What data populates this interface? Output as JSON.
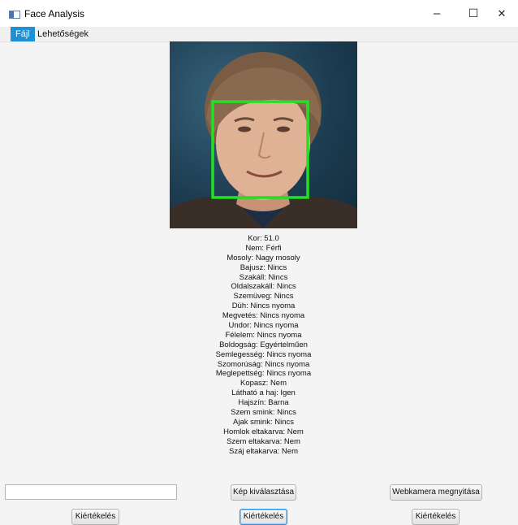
{
  "window": {
    "title": "Face Analysis",
    "icon": "app-window-icon",
    "controls": {
      "minimize": "–",
      "maximize": "☐",
      "close": "✕"
    }
  },
  "menu": {
    "items": [
      {
        "label": "Fájl",
        "active": true
      },
      {
        "label": "Lehetőségek",
        "active": false
      }
    ]
  },
  "image": {
    "description_icon": "face-photo",
    "detection_box_color": "#22e022"
  },
  "results": [
    "Kor: 51.0",
    "Nem: Férfi",
    "Mosoly: Nagy mosoly",
    "Bajusz: Nincs",
    "Szakáll: Nincs",
    "Oldalszakáll: Nincs",
    "Szemüveg: Nincs",
    "Düh: Nincs nyoma",
    "Megvetés: Nincs nyoma",
    "Undor: Nincs nyoma",
    "Félelem: Nincs nyoma",
    "Boldogság: Egyértelműen",
    "Semlegesség: Nincs nyoma",
    "Szomorúság: Nincs nyoma",
    "Meglepettség: Nincs nyoma",
    "Kopasz: Nem",
    "Látható a haj: Igen",
    "Hajszín: Barna",
    "Szem smink: Nincs",
    "Ajak smink: Nincs",
    "Homlok eltakarva: Nem",
    "Szem eltakarva: Nem",
    "Száj eltakarva: Nem"
  ],
  "controls": {
    "path_value": "",
    "choose_image": "Kép kiválasztása",
    "open_webcam": "Webkamera megnyitása",
    "evaluate_left": "Kiértékelés",
    "evaluate_center": "Kiértékelés",
    "evaluate_right": "Kiértékelés"
  },
  "colors": {
    "menu_active": "#1f8fd6",
    "button_focus": "#2e8de0",
    "background": "#f4f4f4"
  }
}
